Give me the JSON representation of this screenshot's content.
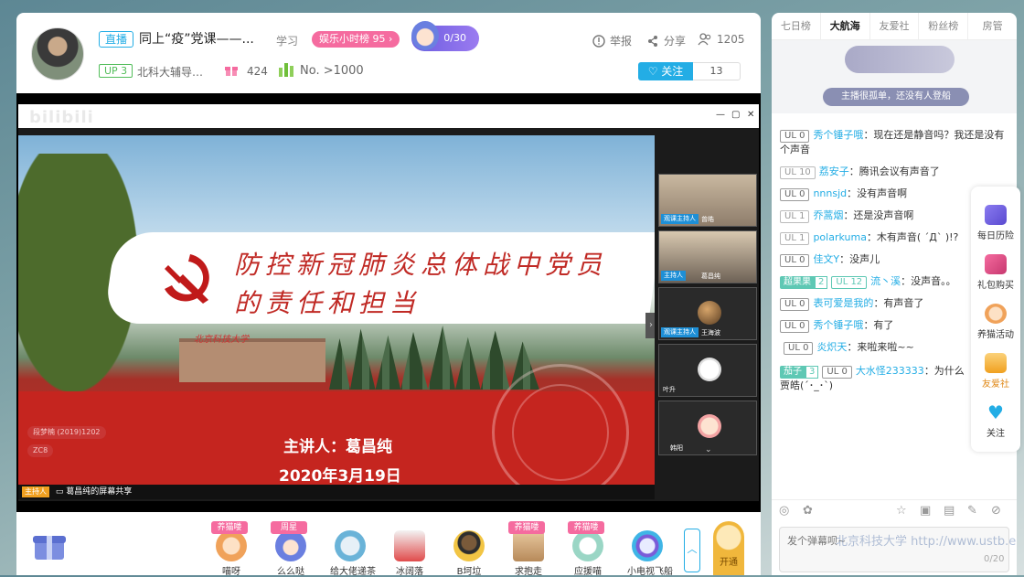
{
  "header": {
    "live_tag": "直播",
    "title": "同上“疫”党课——...",
    "category": "学习",
    "rank_badge": "娱乐小时榜 95",
    "mascot_count": "0/30",
    "up_tag": "UP 3",
    "uploader": "北科大辅导员...",
    "gift_count": "424",
    "rank_no": "No. >1000",
    "report": "举报",
    "share": "分享",
    "viewers": "1205",
    "follow": "关注",
    "follow_count": "13"
  },
  "player": {
    "share_logo": "bilibili",
    "slide": {
      "title_line1": "防控新冠肺炎总体战中党员",
      "title_line2": "的责任和担当",
      "campus_label": "北京科技大学",
      "speaker": "主讲人：葛昌纯",
      "date": "2020年3月19日"
    },
    "participants": [
      {
        "role": "观课主持人",
        "name": "曾皓"
      },
      {
        "role": "主持人",
        "name": "葛昌纯"
      },
      {
        "role": "观课主持人",
        "name": "王海波"
      },
      {
        "role": "",
        "name": "叶升"
      },
      {
        "role": "",
        "name": "韩阳"
      }
    ],
    "host_tag": "主持人",
    "share_caption": "葛昌纯的屏幕共享",
    "danmaku": [
      "段梦楠 (2019)1202",
      "ZC8"
    ]
  },
  "gifts": [
    {
      "name": "喵呀",
      "tag": "养猫喽"
    },
    {
      "name": "么么哒",
      "tag": "周星"
    },
    {
      "name": "给大佬递茶",
      "tag": ""
    },
    {
      "name": "冰阔落",
      "tag": ""
    },
    {
      "name": "B坷垃",
      "tag": ""
    },
    {
      "name": "求抱走",
      "tag": "养猫喽"
    },
    {
      "name": "应援喵",
      "tag": "养猫喽"
    },
    {
      "name": "小电视飞船",
      "tag": ""
    }
  ],
  "gift_bar": {
    "open_label": "开通"
  },
  "rank_tabs": [
    "七日榜",
    "大航海",
    "友爱社",
    "粉丝榜",
    "房管"
  ],
  "rank_empty_text": "主播很孤单，还没有人登船",
  "chat": [
    {
      "level": "UL 0",
      "user": "秀个锤子哦",
      "msg": "：现在还是静音吗？我还是没有个声音"
    },
    {
      "level": "UL 10",
      "user": "荔安子",
      "msg": "：腾讯会议有声音了"
    },
    {
      "level": "UL 0",
      "user": "nnnsjd",
      "msg": "：没有声音啊"
    },
    {
      "level": "UL 1",
      "user": "乔蒿烟",
      "msg": "：还是没声音啊"
    },
    {
      "level": "UL 1",
      "user": "polarkuma",
      "msg": "：木有声音( ´Д` )!?"
    },
    {
      "level": "UL 0",
      "user": "佳文Y",
      "msg": "：没声儿"
    },
    {
      "medal": "超果果",
      "medal_lv": "2",
      "level": "UL 12",
      "user": "流丶溪",
      "msg": "：没声音。。"
    },
    {
      "level": "UL 0",
      "user": "表可爱是我的",
      "msg": "：有声音了"
    },
    {
      "level": "UL 0",
      "user": "秀个锤子哦",
      "msg": "：有了"
    },
    {
      "level": "UL 0",
      "user": "炎炽天",
      "msg": "：来啦来啦~~"
    },
    {
      "medal": "茄子",
      "medal_lv": "3",
      "level": "UL 0",
      "user": "大水怪233333",
      "msg": "：为什么贾皓(´･_･`)"
    }
  ],
  "side_menu": [
    "每日历险",
    "礼包购买",
    "养猫活动",
    "友爱社",
    "关注"
  ],
  "chat_input": {
    "placeholder": "发个弹幕呗~",
    "counter": "0/20"
  },
  "watermark": "北京科技大学 http://www.ustb.edu.cn"
}
